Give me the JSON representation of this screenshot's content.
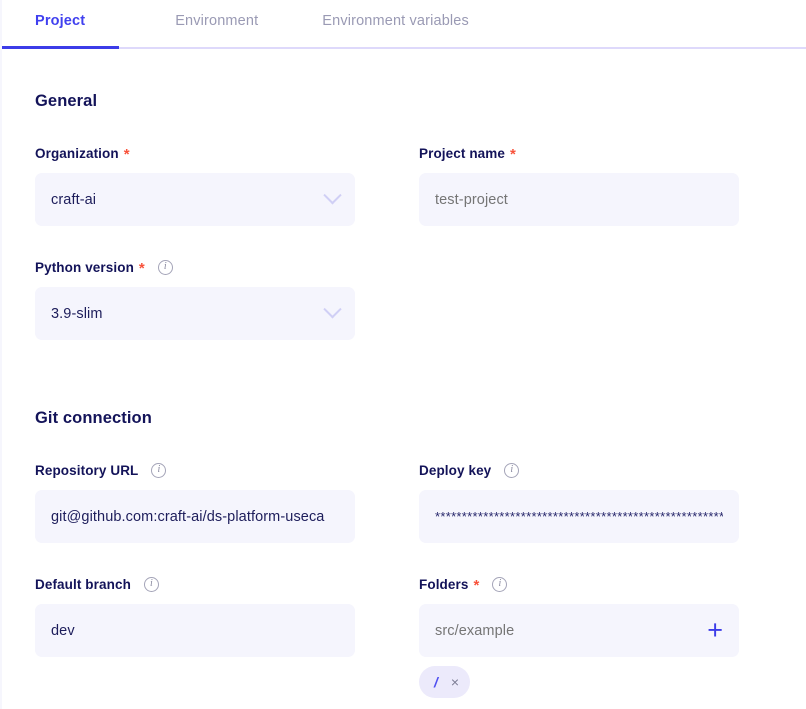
{
  "tabs": [
    {
      "label": "Project",
      "active": true
    },
    {
      "label": "Environment",
      "active": false
    },
    {
      "label": "Environment variables",
      "active": false
    }
  ],
  "sections": {
    "general": {
      "title": "General",
      "organization": {
        "label": "Organization",
        "required": "*",
        "value": "craft-ai",
        "chevron_icon": "chevron-down-icon"
      },
      "project_name": {
        "label": "Project name",
        "required": "*",
        "placeholder": "test-project",
        "value": ""
      },
      "python_version": {
        "label": "Python version",
        "required": "*",
        "info_icon": "info-icon",
        "info_glyph": "i",
        "value": "3.9-slim",
        "chevron_icon": "chevron-down-icon"
      }
    },
    "git": {
      "title": "Git connection",
      "repository_url": {
        "label": "Repository URL",
        "info_icon": "info-icon",
        "info_glyph": "i",
        "value": "git@github.com:craft-ai/ds-platform-useca"
      },
      "deploy_key": {
        "label": "Deploy key",
        "info_icon": "info-icon",
        "info_glyph": "i",
        "value": "******************************************************"
      },
      "default_branch": {
        "label": "Default branch",
        "info_icon": "info-icon",
        "info_glyph": "i",
        "value": "dev"
      },
      "folders": {
        "label": "Folders",
        "required": "*",
        "info_icon": "info-icon",
        "info_glyph": "i",
        "placeholder": "src/example",
        "value": "",
        "add_icon": "plus-icon",
        "add_label": "+",
        "chips": [
          {
            "label": "/",
            "remove_label": "×",
            "remove_icon": "close-icon"
          }
        ]
      }
    }
  },
  "colors": {
    "accent": "#3c3ce8",
    "heading": "#131359",
    "required": "#f8523a",
    "input_bg": "#f5f5fd",
    "placeholder": "#9e9eba",
    "tab_inactive": "#9a9ab4",
    "chip_bg": "#eceafb",
    "chip_text": "#4f4ff0",
    "divider": "#ded9fb"
  }
}
